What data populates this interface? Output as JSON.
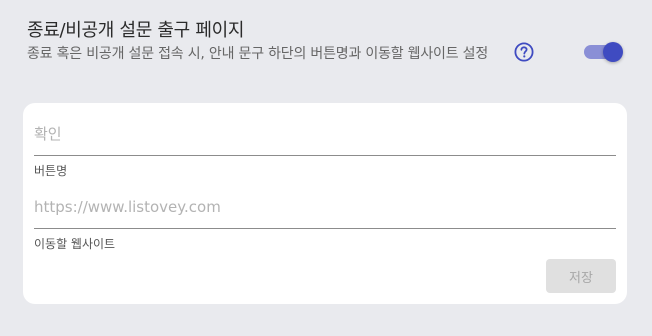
{
  "section": {
    "title": "종료/비공개 설문 출구 페이지",
    "description": "종료 혹은 비공개 설문 접속 시, 안내 문구 하단의 버튼명과 이동할 웹사이트 설정",
    "help_icon": "question-circle-icon",
    "toggle_enabled": true
  },
  "form": {
    "button_name": {
      "value": "",
      "placeholder": "확인",
      "label": "버튼명"
    },
    "website": {
      "value": "",
      "placeholder": "https://www.listovey.com",
      "label": "이동할 웹사이트"
    },
    "save_label": "저장"
  },
  "colors": {
    "background": "#e9eaee",
    "accent": "#3f4bc1",
    "accent_track": "#8a8fd6",
    "disabled_button_bg": "#e0e0e0",
    "disabled_button_text": "#a8a8a8"
  }
}
